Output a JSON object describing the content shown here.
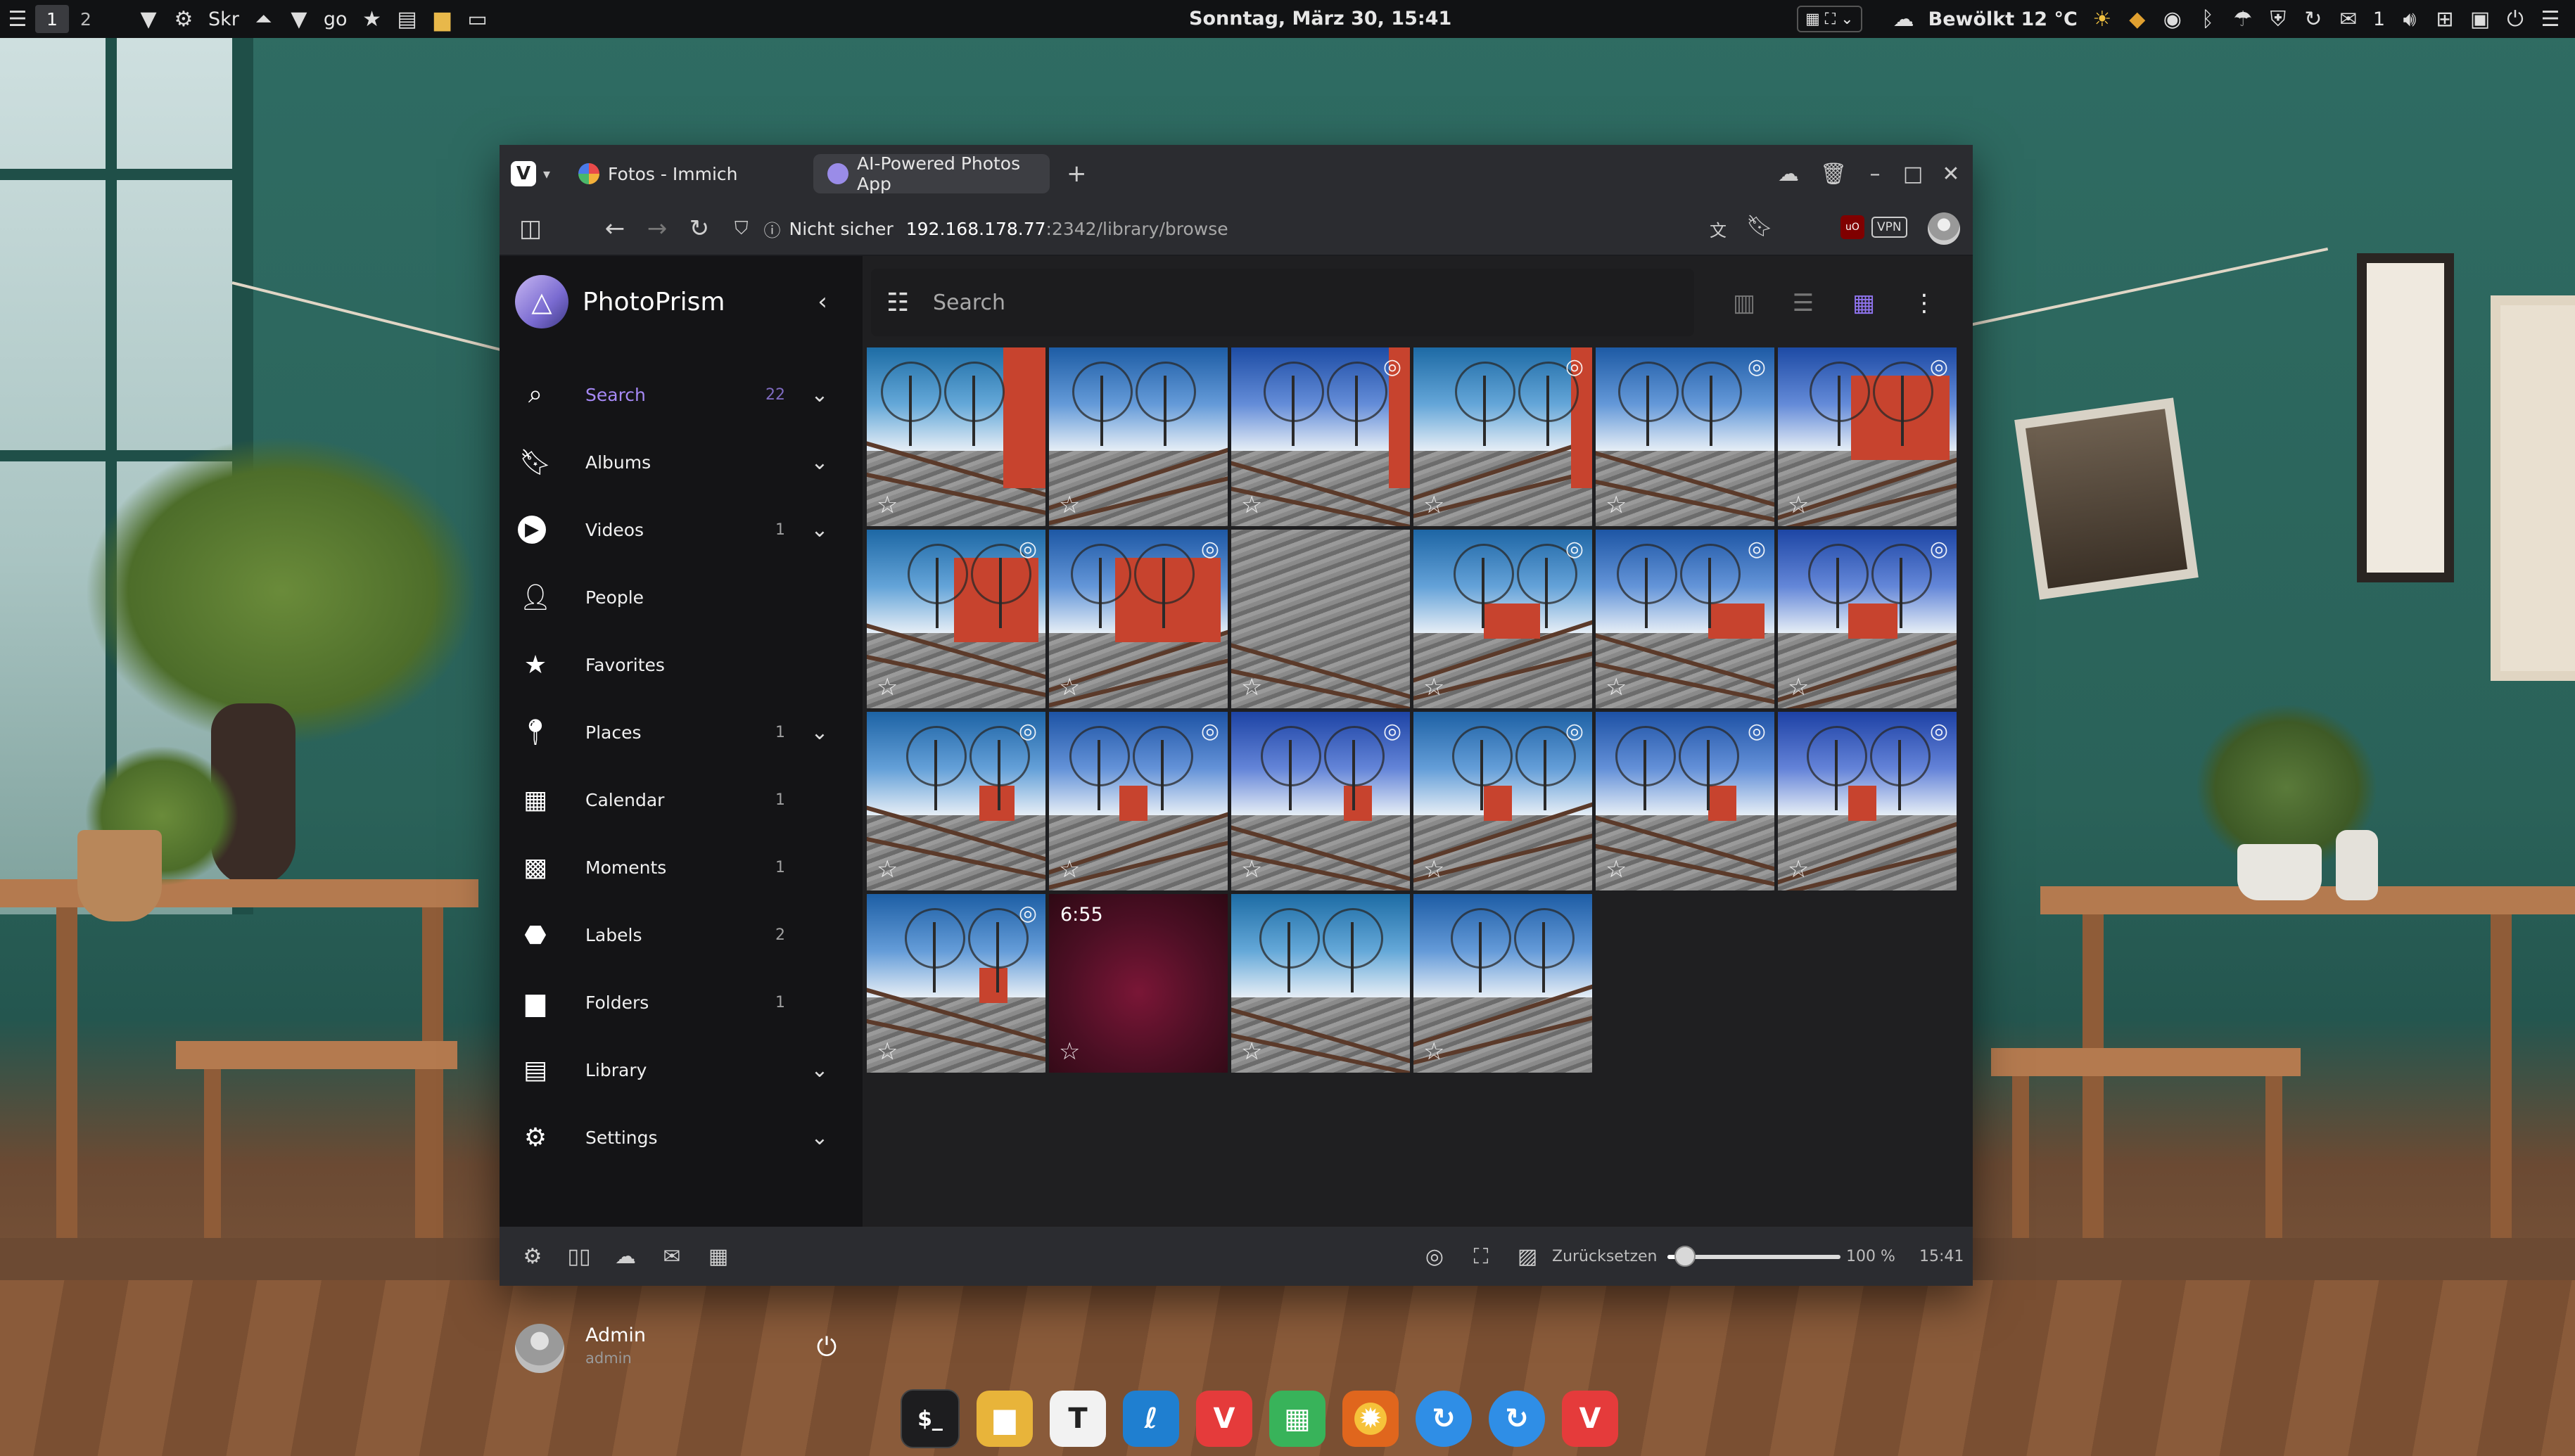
{
  "top_panel": {
    "workspaces": [
      "1",
      "2"
    ],
    "app_label": "Skr",
    "go_label": "go",
    "clock": "Sonntag, März 30, 15:41",
    "weather": "Bewölkt 12 °C",
    "notification_count": "1",
    "icons": [
      "menu-icon",
      "dropdown-icon",
      "gear-icon",
      "chevron-up-icon",
      "star-icon",
      "file-icon",
      "folder-icon",
      "window-icon",
      "cloud-icon",
      "bluetooth-icon",
      "shield-icon",
      "volume-icon",
      "network-icon",
      "power-icon"
    ]
  },
  "browser": {
    "tabs": [
      {
        "label": "Fotos - Immich",
        "favicon_color": "#e94a4a"
      },
      {
        "label": "AI-Powered Photos App",
        "favicon_color": "#9a8ce8"
      }
    ],
    "new_tab": "+",
    "address": {
      "security_label": "Nicht sicher",
      "host": "192.168.178.77",
      "path": ":2342/library/browse"
    },
    "vpn_label": "VPN",
    "ublock_label": "uO",
    "status_bar": {
      "reset_label": "Zurücksetzen",
      "zoom": "100 %",
      "zoom_fraction": 0.1,
      "time": "15:41"
    }
  },
  "app": {
    "brand": "PhotoPrism",
    "search_placeholder": "Search",
    "nav": [
      {
        "label": "Search",
        "count": "22",
        "icon": "search-icon",
        "chevron": true,
        "active": true
      },
      {
        "label": "Albums",
        "count": "",
        "icon": "bookmark-icon",
        "chevron": true
      },
      {
        "label": "Videos",
        "count": "1",
        "icon": "play-icon",
        "chevron": true
      },
      {
        "label": "People",
        "count": "",
        "icon": "person-icon",
        "chevron": false
      },
      {
        "label": "Favorites",
        "count": "",
        "icon": "star-icon",
        "chevron": false
      },
      {
        "label": "Places",
        "count": "1",
        "icon": "location-pin-icon",
        "chevron": true
      },
      {
        "label": "Calendar",
        "count": "1",
        "icon": "calendar-icon",
        "chevron": false
      },
      {
        "label": "Moments",
        "count": "1",
        "icon": "moments-icon",
        "chevron": false
      },
      {
        "label": "Labels",
        "count": "2",
        "icon": "label-icon",
        "chevron": false
      },
      {
        "label": "Folders",
        "count": "1",
        "icon": "folder-icon",
        "chevron": false
      },
      {
        "label": "Library",
        "count": "",
        "icon": "library-icon",
        "chevron": true
      },
      {
        "label": "Settings",
        "count": "",
        "icon": "gear-icon",
        "chevron": true
      }
    ],
    "user": {
      "name": "Admin",
      "login": "admin"
    },
    "video_duration": "6:55",
    "accent_color": "#a689f5"
  }
}
